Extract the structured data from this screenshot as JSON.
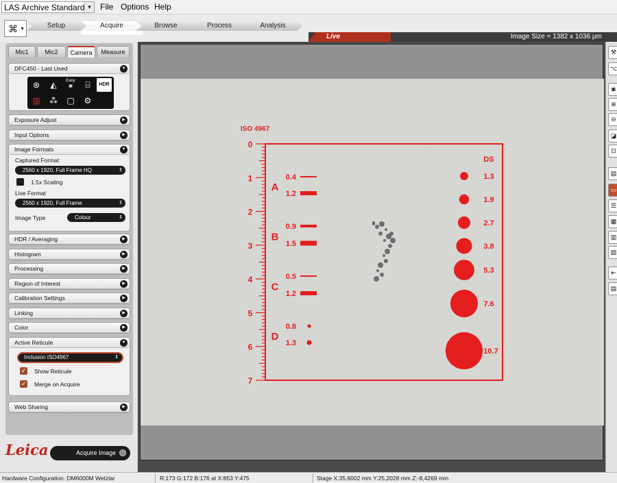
{
  "app": {
    "title": "LAS Archive Standard",
    "menu": [
      "File",
      "Options",
      "Help"
    ]
  },
  "workflow_tabs": [
    {
      "label": "Setup",
      "active": false
    },
    {
      "label": "Acquire",
      "active": true
    },
    {
      "label": "Browse",
      "active": false
    },
    {
      "label": "Process",
      "active": false
    },
    {
      "label": "Analysis",
      "active": false
    }
  ],
  "live_bar": {
    "mode": "Live",
    "image_size": "Image Size = 1382 x 1036 µm"
  },
  "left_panel": {
    "subtabs": [
      {
        "label": "Mic1",
        "active": false
      },
      {
        "label": "Mic2",
        "active": false
      },
      {
        "label": "Camera",
        "active": true
      },
      {
        "label": "Measure",
        "active": false
      }
    ],
    "camera_section": {
      "title": "DFC450 - Last Used",
      "buttons": [
        {
          "icon": "aperture-icon"
        },
        {
          "icon": "exposure-icon"
        },
        {
          "icon": "easy-camera-icon",
          "label": "Easy"
        },
        {
          "icon": "camera-settings-icon"
        },
        {
          "icon": "hdr-icon",
          "label": "HDR"
        },
        {
          "icon": "color-balance-icon"
        },
        {
          "icon": "molecule-icon"
        },
        {
          "icon": "frame-icon"
        },
        {
          "icon": "adjust-icon"
        }
      ]
    },
    "sections": {
      "exposure_adjust": "Exposure Adjust",
      "input_options": "Input Options",
      "image_formats": "Image Formats",
      "hdr_averaging": "HDR / Averaging",
      "histogram": "Histogram",
      "processing": "Processing",
      "region_of_interest": "Region of Interest",
      "calibration_settings": "Calibration Settings",
      "linking": "Linking",
      "color": "Color",
      "active_reticule": "Active Reticule",
      "web_sharing": "Web Sharing"
    },
    "image_formats": {
      "captured_format_label": "Captured Format",
      "captured_format_value": "2560 x 1920,     Full Frame HQ",
      "scaling_label": "1.5x Scaling",
      "scaling_checked": false,
      "live_format_label": "Live Format",
      "live_format_value": "2560 x 1920,     Full Frame",
      "image_type_label": "Image Type",
      "image_type_value": "Colour"
    },
    "active_reticule": {
      "reticule_value": "Inclusion ISO4967",
      "show_reticule_label": "Show Reticule",
      "show_reticule_checked": true,
      "merge_on_acquire_label": "Merge on Acquire",
      "merge_on_acquire_checked": true
    },
    "logo": "Leica",
    "acquire_button": "Acquire Image"
  },
  "reticle": {
    "title": "ISO 4967",
    "scale_ticks": [
      "0",
      "1",
      "2",
      "3",
      "4",
      "5",
      "6",
      "7"
    ],
    "ds_header": "DS",
    "groups": [
      {
        "letter": "A",
        "widths": [
          "0.4",
          "1.2"
        ]
      },
      {
        "letter": "B",
        "widths": [
          "0.9",
          "1.5"
        ]
      },
      {
        "letter": "C",
        "widths": [
          "0.5",
          "1.2"
        ]
      },
      {
        "letter": "D",
        "widths": [
          "0.8",
          "1.3"
        ]
      }
    ],
    "ds_values": [
      "1.3",
      "1.9",
      "2.7",
      "3.8",
      "5.3",
      "7.6",
      "10.7"
    ],
    "color": "#e41e1e"
  },
  "status_bar": {
    "hardware": "Hardware Configuration: DM6000M Wetzlar",
    "pixel": "R:173  G:172  B:176  at  X:853  Y:475",
    "stage": "Stage X:35,6002 mm  Y:25,2028 mm  Z:-8,4269 mm"
  }
}
